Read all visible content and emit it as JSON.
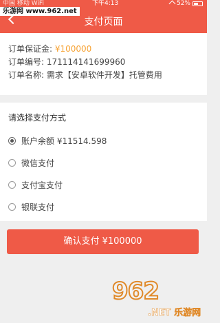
{
  "status_bar": {
    "carrier": "中国 移动 WiFi",
    "time": "下午4:13",
    "battery": "52%"
  },
  "watermark_top": "乐游网 www.962.net",
  "header": {
    "title": "支付页面"
  },
  "order": {
    "deposit_label": "订单保证金: ",
    "deposit_value": "¥100000",
    "number_line": "订单编号: 171114141699960",
    "name_line": "订单名称: 需求【安卓软件开发】托管费用"
  },
  "payment": {
    "heading": "请选择支付方式",
    "options": [
      {
        "label": "账户余额 ¥11514.598",
        "selected": true
      },
      {
        "label": "微信支付",
        "selected": false
      },
      {
        "label": "支付宝支付",
        "selected": false
      },
      {
        "label": "银联支付",
        "selected": false
      }
    ]
  },
  "confirm_button": "确认支付 ¥100000",
  "watermark_logo": {
    "main": "962",
    "sub": ".NET 乐游网"
  }
}
